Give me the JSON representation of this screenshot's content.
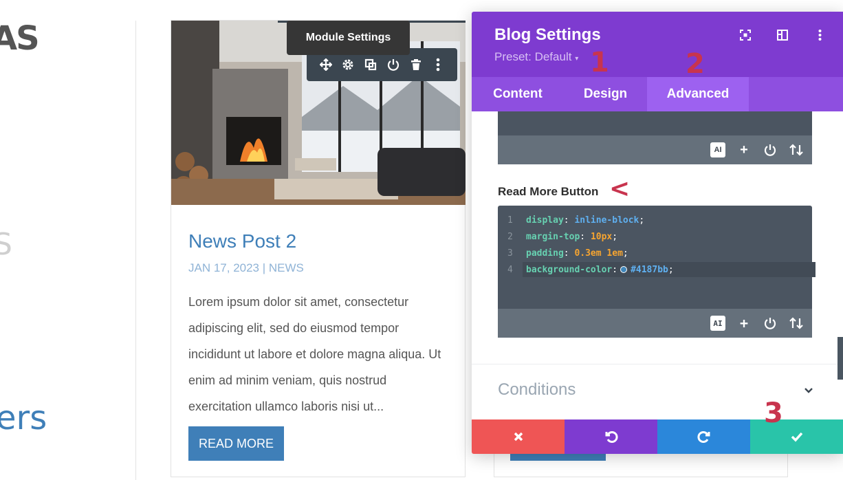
{
  "left_column": {
    "top_fragment": "AS",
    "middle_fragment": "S",
    "bottom_fragment": "ers"
  },
  "card": {
    "title": "News Post 2",
    "meta": "JAN 17, 2023 | NEWS",
    "excerpt": "Lorem ipsum dolor sit amet, consectetur adipiscing elit, sed do eiusmod tempor incididunt ut labore et dolore magna aliqua. Ut enim ad minim veniam, quis nostrud exercitation ullamco laboris nisi ut...",
    "button_label": "READ MORE"
  },
  "module_toolbar": {
    "tooltip": "Module Settings",
    "icons": [
      "move-icon",
      "gear-icon",
      "duplicate-icon",
      "power-icon",
      "trash-icon",
      "more-icon"
    ]
  },
  "panel": {
    "title": "Blog Settings",
    "preset": "Preset: Default",
    "header_icons": [
      "focus-icon",
      "sidebar-icon",
      "more-icon"
    ],
    "tabs": [
      {
        "label": "Content"
      },
      {
        "label": "Design"
      },
      {
        "label": "Advanced"
      }
    ],
    "active_tab": "Advanced",
    "field_label": "Read More Button",
    "editor_tools": [
      "AI",
      "+",
      "power-icon",
      "sort-icon"
    ],
    "code_lines": [
      {
        "n": "1",
        "prop": "display",
        "value": "inline-block"
      },
      {
        "n": "2",
        "prop": "margin-top",
        "value": "10px"
      },
      {
        "n": "3",
        "prop": "padding",
        "value": "0.3em 1em"
      },
      {
        "n": "4",
        "prop": "background-color",
        "value": "#4187bb"
      }
    ],
    "conditions_label": "Conditions"
  },
  "annotations": {
    "step1": "1",
    "step2": "2",
    "step3": "3",
    "arrow": "<"
  },
  "colors": {
    "panel_purple": "#7e3bd0",
    "tab_purple": "#8e4fe0",
    "accent_blue": "#3f7fb8",
    "annotation_red": "#c8344e",
    "swatch": "#4187bb"
  }
}
